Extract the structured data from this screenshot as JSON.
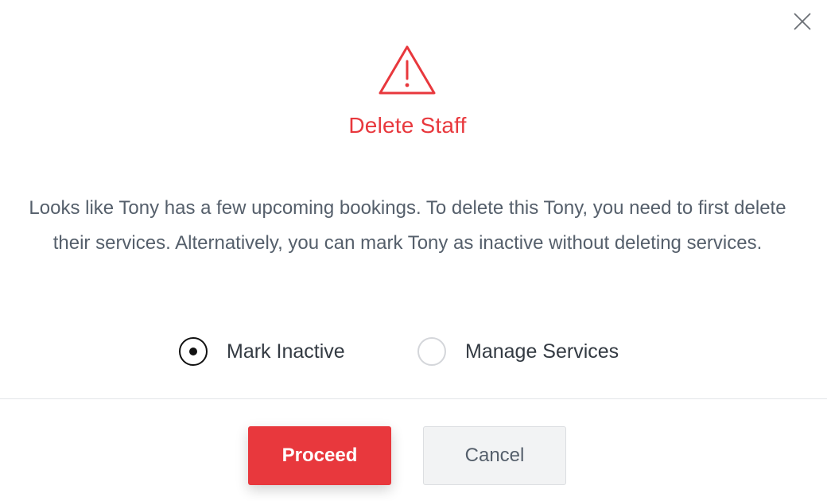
{
  "dialog": {
    "title": "Delete Staff",
    "message": "Looks like Tony has a few upcoming bookings. To delete this Tony, you need to first delete their services. Alternatively, you can mark Tony as inactive without deleting services.",
    "options": [
      {
        "label": "Mark Inactive",
        "selected": true
      },
      {
        "label": "Manage Services",
        "selected": false
      }
    ],
    "buttons": {
      "proceed_label": "Proceed",
      "cancel_label": "Cancel"
    },
    "icons": {
      "close": "close-icon",
      "warning": "warning-icon"
    }
  },
  "colors": {
    "accent": "#e8383d",
    "text": "#555f6b",
    "label": "#333a42"
  }
}
